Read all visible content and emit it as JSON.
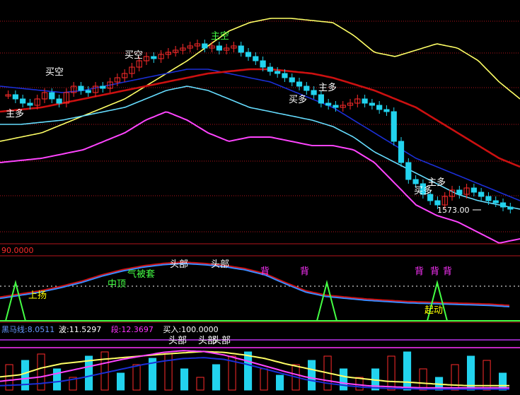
{
  "colors": {
    "background": "#000000",
    "grid_red": "#b3141c",
    "candle_up": "#ff2b2b",
    "candle_down": "#22d3ee",
    "ma_white": "#e8e8e8",
    "ma_yellow": "#ffff66",
    "ma_pink": "#ff44ff",
    "ma_red": "#cc1010",
    "ma_blue": "#1b2fd6",
    "ma_cyan": "#66ddff",
    "ma_green": "#44aa44",
    "signal_green": "#44ff44",
    "label_white": "#ffffff",
    "label_green": "#44ff44",
    "label_yellow": "#ffff00",
    "label_magenta": "#ff33ff",
    "info_blue": "#6699ff"
  },
  "main_panel": {
    "price_marker": "1573.00",
    "signals": [
      {
        "text": "主多",
        "color": "white"
      },
      {
        "text": "买空",
        "color": "white"
      },
      {
        "text": "买空",
        "color": "white"
      },
      {
        "text": "主空",
        "color": "green"
      },
      {
        "text": "买多",
        "color": "white"
      },
      {
        "text": "主多",
        "color": "white"
      },
      {
        "text": "买多",
        "color": "white"
      },
      {
        "text": "主多",
        "color": "white"
      }
    ]
  },
  "mid_panel": {
    "header_value": "90.0000",
    "labels": [
      {
        "text": "上扬",
        "color": "yellow"
      },
      {
        "text": "中顶",
        "color": "green"
      },
      {
        "text": "气被套",
        "color": "green"
      },
      {
        "text": "头部",
        "color": "white"
      },
      {
        "text": "头部",
        "color": "white"
      },
      {
        "text": "背",
        "color": "magenta"
      },
      {
        "text": "背",
        "color": "magenta"
      },
      {
        "text": "背",
        "color": "magenta"
      },
      {
        "text": "背",
        "color": "magenta"
      },
      {
        "text": "背",
        "color": "magenta"
      },
      {
        "text": "起动",
        "color": "yellow"
      }
    ]
  },
  "bottom_panel": {
    "info": [
      {
        "label": "黑马线:",
        "value": "8.0511",
        "color": "#6699ff"
      },
      {
        "label": "波:",
        "value": "11.5297",
        "color": "#ffffff"
      },
      {
        "label": "段:",
        "value": "12.3697",
        "color": "#ff33ff"
      },
      {
        "label": "买入:",
        "value": "100.0000",
        "color": "#ffffff"
      }
    ],
    "labels": [
      {
        "text": "头部"
      },
      {
        "text": "头部"
      },
      {
        "text": "头部"
      }
    ]
  },
  "chart_data": [
    {
      "type": "line",
      "title": "",
      "xlabel": "",
      "ylabel": "",
      "candles_close": [
        0.62,
        0.6,
        0.58,
        0.57,
        0.6,
        0.63,
        0.6,
        0.58,
        0.63,
        0.66,
        0.64,
        0.63,
        0.66,
        0.65,
        0.68,
        0.7,
        0.72,
        0.75,
        0.78,
        0.8,
        0.79,
        0.81,
        0.82,
        0.83,
        0.84,
        0.85,
        0.86,
        0.84,
        0.85,
        0.83,
        0.84,
        0.85,
        0.82,
        0.8,
        0.78,
        0.75,
        0.73,
        0.72,
        0.7,
        0.68,
        0.66,
        0.64,
        0.62,
        0.58,
        0.57,
        0.56,
        0.57,
        0.58,
        0.6,
        0.58,
        0.57,
        0.55,
        0.54,
        0.4,
        0.3,
        0.22,
        0.2,
        0.15,
        0.12,
        0.1,
        0.14,
        0.17,
        0.15,
        0.18,
        0.16,
        0.14,
        0.12,
        0.11,
        0.09,
        0.08
      ],
      "series": [
        {
          "name": "",
          "values": [
            0.4,
            0.42,
            0.44,
            0.48,
            0.52,
            0.56,
            0.6,
            0.66,
            0.72,
            0.78,
            0.85,
            0.92,
            0.96,
            0.98,
            0.98,
            0.97,
            0.96,
            0.9,
            0.82,
            0.8,
            0.83,
            0.86,
            0.84,
            0.78,
            0.68,
            0.6
          ]
        },
        {
          "name": "",
          "values": [
            0.66,
            0.65,
            0.64,
            0.63,
            0.64,
            0.66,
            0.68,
            0.7,
            0.72,
            0.74,
            0.74,
            0.72,
            0.7,
            0.68,
            0.64,
            0.6,
            0.56,
            0.5,
            0.44,
            0.38,
            0.32,
            0.28,
            0.24,
            0.2,
            0.16,
            0.12
          ]
        },
        {
          "name": "",
          "values": [
            0.54,
            0.55,
            0.56,
            0.58,
            0.6,
            0.62,
            0.64,
            0.66,
            0.68,
            0.7,
            0.72,
            0.73,
            0.74,
            0.74,
            0.73,
            0.72,
            0.7,
            0.67,
            0.64,
            0.6,
            0.56,
            0.5,
            0.44,
            0.38,
            0.32,
            0.28
          ]
        },
        {
          "name": "",
          "values": [
            0.48,
            0.48,
            0.49,
            0.5,
            0.52,
            0.54,
            0.56,
            0.6,
            0.64,
            0.66,
            0.64,
            0.6,
            0.56,
            0.54,
            0.52,
            0.5,
            0.47,
            0.42,
            0.35,
            0.3,
            0.25,
            0.2,
            0.15,
            0.12,
            0.1,
            0.08
          ]
        },
        {
          "name": "",
          "values": [
            0.3,
            0.31,
            0.32,
            0.34,
            0.36,
            0.4,
            0.44,
            0.5,
            0.54,
            0.5,
            0.44,
            0.4,
            0.42,
            0.42,
            0.4,
            0.38,
            0.38,
            0.36,
            0.3,
            0.2,
            0.1,
            0.05,
            0.02,
            -0.03,
            -0.08,
            -0.06
          ]
        }
      ],
      "ylim": [
        0,
        1
      ]
    },
    {
      "type": "line",
      "title": "",
      "series": [
        {
          "name": "",
          "values": [
            0.35,
            0.4,
            0.45,
            0.52,
            0.6,
            0.7,
            0.78,
            0.84,
            0.88,
            0.9,
            0.88,
            0.85,
            0.8,
            0.72,
            0.58,
            0.45,
            0.38,
            0.35,
            0.32,
            0.3,
            0.28,
            0.27,
            0.26,
            0.25,
            0.24,
            0.22
          ]
        },
        {
          "name": "",
          "values": [
            0,
            0,
            1,
            0,
            0,
            0,
            0,
            0,
            0,
            0,
            0,
            0,
            0,
            0,
            0,
            0,
            1,
            0,
            0,
            0,
            0,
            1,
            0,
            0,
            0,
            0
          ]
        }
      ],
      "ylim": [
        0,
        1
      ]
    },
    {
      "type": "bar",
      "title": "",
      "values": [
        0.6,
        0.7,
        0.85,
        0.5,
        0.3,
        0.8,
        0.9,
        0.4,
        0.6,
        0.75,
        0.85,
        0.5,
        0.3,
        0.6,
        0.8,
        0.9,
        0.5,
        0.35,
        0.6,
        0.7,
        0.8,
        0.5,
        0.3,
        0.5,
        0.8,
        0.9,
        0.5,
        0.3,
        0.6,
        0.8,
        0.7,
        0.4
      ],
      "series": [
        {
          "name": "",
          "values": [
            0.3,
            0.35,
            0.5,
            0.6,
            0.65,
            0.7,
            0.74,
            0.78,
            0.82,
            0.85,
            0.88,
            0.86,
            0.8,
            0.72,
            0.6,
            0.5,
            0.4,
            0.3,
            0.25,
            0.2,
            0.18,
            0.15,
            0.12,
            0.1,
            0.1,
            0.1
          ]
        },
        {
          "name": "",
          "values": [
            0.2,
            0.25,
            0.3,
            0.4,
            0.5,
            0.6,
            0.7,
            0.78,
            0.86,
            0.9,
            0.88,
            0.8,
            0.68,
            0.55,
            0.42,
            0.3,
            0.22,
            0.15,
            0.1,
            0.08,
            0.06,
            0.05,
            0.05,
            0.05,
            0.05,
            0.05
          ]
        },
        {
          "name": "",
          "values": [
            0.1,
            0.12,
            0.15,
            0.2,
            0.28,
            0.38,
            0.48,
            0.58,
            0.66,
            0.72,
            0.74,
            0.7,
            0.6,
            0.48,
            0.36,
            0.24,
            0.16,
            0.1,
            0.06,
            0.04,
            0.03,
            0.02,
            0.02,
            0.02,
            0.02,
            0.02
          ]
        }
      ],
      "ylim": [
        0,
        1
      ]
    }
  ]
}
